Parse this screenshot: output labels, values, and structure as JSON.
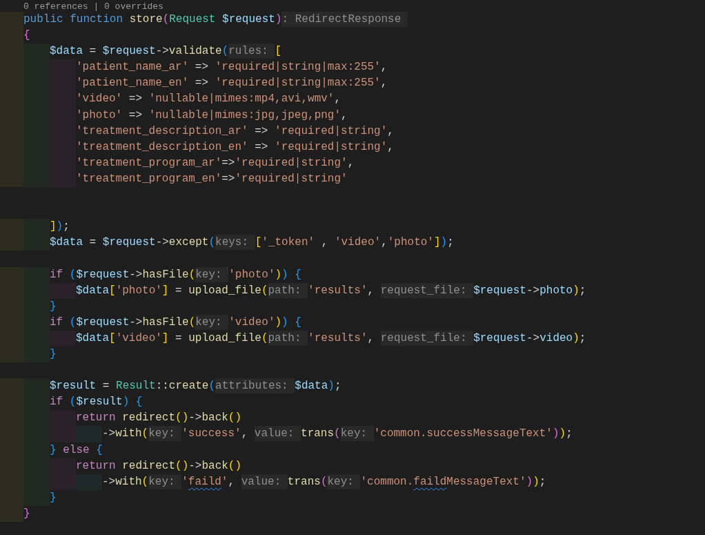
{
  "editor": {
    "codelens": "0 references | 0 overrides",
    "lines": [
      {
        "kind": "code",
        "tokens": [
          {
            "kind": "storage",
            "text": "public function "
          },
          {
            "kind": "function",
            "text": "store"
          },
          {
            "kind": "bracket",
            "text": "(",
            "color": "#da70d6"
          },
          {
            "kind": "type",
            "text": "Request "
          },
          {
            "kind": "variable",
            "text": "$request"
          },
          {
            "kind": "bracket",
            "text": ")",
            "color": "#da70d6"
          },
          {
            "kind": "hint",
            "text": ": RedirectResponse"
          }
        ]
      },
      {
        "kind": "code",
        "tokens": [
          {
            "kind": "bracket",
            "text": "{",
            "color": "#da70d6"
          }
        ],
        "children": [
          {
            "kind": "code",
            "tokens": [
              {
                "kind": "variable",
                "text": "$data"
              },
              {
                "kind": "plain",
                "text": " = "
              },
              {
                "kind": "variable",
                "text": "$request"
              },
              {
                "kind": "plain",
                "text": "->"
              },
              {
                "kind": "function",
                "text": "validate"
              },
              {
                "kind": "bracket",
                "text": "(",
                "color": "#179fff"
              },
              {
                "kind": "hint",
                "text": "rules:"
              },
              {
                "kind": "bracket",
                "text": "[",
                "color": "#ffd700"
              }
            ],
            "children": [
              {
                "kind": "code",
                "tokens": [
                  {
                    "kind": "string",
                    "text": "'patient_name_ar'"
                  },
                  {
                    "kind": "plain",
                    "text": " => "
                  },
                  {
                    "kind": "string",
                    "text": "'required|string|max:255'"
                  },
                  {
                    "kind": "plain",
                    "text": ","
                  }
                ]
              },
              {
                "kind": "code",
                "tokens": [
                  {
                    "kind": "string",
                    "text": "'patient_name_en'"
                  },
                  {
                    "kind": "plain",
                    "text": " => "
                  },
                  {
                    "kind": "string",
                    "text": "'required|string|max:255'"
                  },
                  {
                    "kind": "plain",
                    "text": ","
                  }
                ]
              },
              {
                "kind": "code",
                "tokens": [
                  {
                    "kind": "string",
                    "text": "'video'"
                  },
                  {
                    "kind": "plain",
                    "text": " => "
                  },
                  {
                    "kind": "string",
                    "text": "'nullable|mimes:mp4,avi,wmv'"
                  },
                  {
                    "kind": "plain",
                    "text": ","
                  }
                ]
              },
              {
                "kind": "code",
                "tokens": [
                  {
                    "kind": "string",
                    "text": "'photo'"
                  },
                  {
                    "kind": "plain",
                    "text": " => "
                  },
                  {
                    "kind": "string",
                    "text": "'nullable|mimes:jpg,jpeg,png'"
                  },
                  {
                    "kind": "plain",
                    "text": ","
                  }
                ]
              },
              {
                "kind": "code",
                "tokens": [
                  {
                    "kind": "string",
                    "text": "'treatment_description_ar'"
                  },
                  {
                    "kind": "plain",
                    "text": " => "
                  },
                  {
                    "kind": "string",
                    "text": "'required|string'"
                  },
                  {
                    "kind": "plain",
                    "text": ","
                  }
                ]
              },
              {
                "kind": "code",
                "tokens": [
                  {
                    "kind": "string",
                    "text": "'treatment_description_en'"
                  },
                  {
                    "kind": "plain",
                    "text": " => "
                  },
                  {
                    "kind": "string",
                    "text": "'required|string'"
                  },
                  {
                    "kind": "plain",
                    "text": ","
                  }
                ]
              },
              {
                "kind": "code",
                "tokens": [
                  {
                    "kind": "string",
                    "text": "'treatment_program_ar'"
                  },
                  {
                    "kind": "plain",
                    "text": "=>"
                  },
                  {
                    "kind": "string",
                    "text": "'required|string'"
                  },
                  {
                    "kind": "plain",
                    "text": ","
                  }
                ]
              },
              {
                "kind": "code",
                "tokens": [
                  {
                    "kind": "string",
                    "text": "'treatment_program_en'"
                  },
                  {
                    "kind": "plain",
                    "text": "=>"
                  },
                  {
                    "kind": "string",
                    "text": "'required|string'"
                  }
                ]
              },
              {
                "kind": "blank"
              },
              {
                "kind": "blank"
              }
            ]
          },
          {
            "kind": "code",
            "tokens": [
              {
                "kind": "bracket",
                "text": "]",
                "color": "#ffd700"
              },
              {
                "kind": "bracket",
                "text": ")",
                "color": "#179fff"
              },
              {
                "kind": "plain",
                "text": ";"
              }
            ]
          },
          {
            "kind": "code",
            "tokens": [
              {
                "kind": "variable",
                "text": "$data"
              },
              {
                "kind": "plain",
                "text": " = "
              },
              {
                "kind": "variable",
                "text": "$request"
              },
              {
                "kind": "plain",
                "text": "->"
              },
              {
                "kind": "function",
                "text": "except"
              },
              {
                "kind": "bracket",
                "text": "(",
                "color": "#179fff"
              },
              {
                "kind": "hint",
                "text": "keys:"
              },
              {
                "kind": "bracket",
                "text": "[",
                "color": "#ffd700"
              },
              {
                "kind": "string",
                "text": "'_token'"
              },
              {
                "kind": "plain",
                "text": " , "
              },
              {
                "kind": "string",
                "text": "'video'"
              },
              {
                "kind": "plain",
                "text": ","
              },
              {
                "kind": "string",
                "text": "'photo'"
              },
              {
                "kind": "bracket",
                "text": "]",
                "color": "#ffd700"
              },
              {
                "kind": "bracket",
                "text": ")",
                "color": "#179fff"
              },
              {
                "kind": "plain",
                "text": ";"
              }
            ]
          },
          {
            "kind": "blank"
          },
          {
            "kind": "code",
            "tokens": [
              {
                "kind": "control",
                "text": "if "
              },
              {
                "kind": "bracket",
                "text": "(",
                "color": "#179fff"
              },
              {
                "kind": "variable",
                "text": "$request"
              },
              {
                "kind": "plain",
                "text": "->"
              },
              {
                "kind": "function",
                "text": "hasFile"
              },
              {
                "kind": "bracket",
                "text": "(",
                "color": "#ffd700"
              },
              {
                "kind": "hint",
                "text": "key:"
              },
              {
                "kind": "string",
                "text": "'photo'"
              },
              {
                "kind": "bracket",
                "text": ")",
                "color": "#ffd700"
              },
              {
                "kind": "bracket",
                "text": ")",
                "color": "#179fff"
              },
              {
                "kind": "bracket",
                "text": " {",
                "color": "#179fff"
              }
            ],
            "children": [
              {
                "kind": "code",
                "tokens": [
                  {
                    "kind": "variable",
                    "text": "$data"
                  },
                  {
                    "kind": "bracket",
                    "text": "[",
                    "color": "#ffd700"
                  },
                  {
                    "kind": "string",
                    "text": "'photo'"
                  },
                  {
                    "kind": "bracket",
                    "text": "]",
                    "color": "#ffd700"
                  },
                  {
                    "kind": "plain",
                    "text": " = "
                  },
                  {
                    "kind": "function",
                    "text": "upload_file"
                  },
                  {
                    "kind": "bracket",
                    "text": "(",
                    "color": "#ffd700"
                  },
                  {
                    "kind": "hint",
                    "text": "path:"
                  },
                  {
                    "kind": "string",
                    "text": "'results'"
                  },
                  {
                    "kind": "plain",
                    "text": ", "
                  },
                  {
                    "kind": "hint",
                    "text": "request_file:"
                  },
                  {
                    "kind": "variable",
                    "text": "$request"
                  },
                  {
                    "kind": "plain",
                    "text": "->"
                  },
                  {
                    "kind": "variable",
                    "text": "photo"
                  },
                  {
                    "kind": "bracket",
                    "text": ")",
                    "color": "#ffd700"
                  },
                  {
                    "kind": "plain",
                    "text": ";"
                  }
                ]
              }
            ]
          },
          {
            "kind": "code",
            "tokens": [
              {
                "kind": "bracket",
                "text": "}",
                "color": "#179fff"
              }
            ]
          },
          {
            "kind": "code",
            "tokens": [
              {
                "kind": "control",
                "text": "if "
              },
              {
                "kind": "bracket",
                "text": "(",
                "color": "#179fff"
              },
              {
                "kind": "variable",
                "text": "$request"
              },
              {
                "kind": "plain",
                "text": "->"
              },
              {
                "kind": "function",
                "text": "hasFile"
              },
              {
                "kind": "bracket",
                "text": "(",
                "color": "#ffd700"
              },
              {
                "kind": "hint",
                "text": "key:"
              },
              {
                "kind": "string",
                "text": "'video'"
              },
              {
                "kind": "bracket",
                "text": ")",
                "color": "#ffd700"
              },
              {
                "kind": "bracket",
                "text": ")",
                "color": "#179fff"
              },
              {
                "kind": "bracket",
                "text": " {",
                "color": "#179fff"
              }
            ],
            "children": [
              {
                "kind": "code",
                "tokens": [
                  {
                    "kind": "variable",
                    "text": "$data"
                  },
                  {
                    "kind": "bracket",
                    "text": "[",
                    "color": "#ffd700"
                  },
                  {
                    "kind": "string",
                    "text": "'video'"
                  },
                  {
                    "kind": "bracket",
                    "text": "]",
                    "color": "#ffd700"
                  },
                  {
                    "kind": "plain",
                    "text": " = "
                  },
                  {
                    "kind": "function",
                    "text": "upload_file"
                  },
                  {
                    "kind": "bracket",
                    "text": "(",
                    "color": "#ffd700"
                  },
                  {
                    "kind": "hint",
                    "text": "path:"
                  },
                  {
                    "kind": "string",
                    "text": "'results'"
                  },
                  {
                    "kind": "plain",
                    "text": ", "
                  },
                  {
                    "kind": "hint",
                    "text": "request_file:"
                  },
                  {
                    "kind": "variable",
                    "text": "$request"
                  },
                  {
                    "kind": "plain",
                    "text": "->"
                  },
                  {
                    "kind": "variable",
                    "text": "video"
                  },
                  {
                    "kind": "bracket",
                    "text": ")",
                    "color": "#ffd700"
                  },
                  {
                    "kind": "plain",
                    "text": ";"
                  }
                ]
              }
            ]
          },
          {
            "kind": "code",
            "tokens": [
              {
                "kind": "bracket",
                "text": "}",
                "color": "#179fff"
              }
            ]
          },
          {
            "kind": "blank"
          },
          {
            "kind": "code",
            "tokens": [
              {
                "kind": "variable",
                "text": "$result"
              },
              {
                "kind": "plain",
                "text": " = "
              },
              {
                "kind": "type",
                "text": "Result"
              },
              {
                "kind": "plain",
                "text": "::"
              },
              {
                "kind": "function",
                "text": "create"
              },
              {
                "kind": "bracket",
                "text": "(",
                "color": "#179fff"
              },
              {
                "kind": "hint",
                "text": "attributes:"
              },
              {
                "kind": "variable",
                "text": "$data"
              },
              {
                "kind": "bracket",
                "text": ")",
                "color": "#179fff"
              },
              {
                "kind": "plain",
                "text": ";"
              }
            ]
          },
          {
            "kind": "code",
            "tokens": [
              {
                "kind": "control",
                "text": "if "
              },
              {
                "kind": "bracket",
                "text": "(",
                "color": "#179fff"
              },
              {
                "kind": "variable",
                "text": "$result"
              },
              {
                "kind": "bracket",
                "text": ")",
                "color": "#179fff"
              },
              {
                "kind": "bracket",
                "text": " {",
                "color": "#179fff"
              }
            ],
            "children": [
              {
                "kind": "code",
                "tokens": [
                  {
                    "kind": "control",
                    "text": "return "
                  },
                  {
                    "kind": "function",
                    "text": "redirect"
                  },
                  {
                    "kind": "bracket",
                    "text": "(",
                    "color": "#ffd700"
                  },
                  {
                    "kind": "bracket",
                    "text": ")",
                    "color": "#ffd700"
                  },
                  {
                    "kind": "plain",
                    "text": "->"
                  },
                  {
                    "kind": "function",
                    "text": "back"
                  },
                  {
                    "kind": "bracket",
                    "text": "(",
                    "color": "#ffd700"
                  },
                  {
                    "kind": "bracket",
                    "text": ")",
                    "color": "#ffd700"
                  }
                ],
                "children": [
                  {
                    "kind": "code",
                    "tokens": [
                      {
                        "kind": "plain",
                        "text": "->"
                      },
                      {
                        "kind": "function",
                        "text": "with"
                      },
                      {
                        "kind": "bracket",
                        "text": "(",
                        "color": "#ffd700"
                      },
                      {
                        "kind": "hint",
                        "text": "key:"
                      },
                      {
                        "kind": "string",
                        "text": "'success'"
                      },
                      {
                        "kind": "plain",
                        "text": ", "
                      },
                      {
                        "kind": "hint",
                        "text": "value:"
                      },
                      {
                        "kind": "function",
                        "text": "trans"
                      },
                      {
                        "kind": "bracket",
                        "text": "(",
                        "color": "#da70d6"
                      },
                      {
                        "kind": "hint",
                        "text": "key:"
                      },
                      {
                        "kind": "string",
                        "text": "'common.successMessageText'"
                      },
                      {
                        "kind": "bracket",
                        "text": ")",
                        "color": "#da70d6"
                      },
                      {
                        "kind": "bracket",
                        "text": ")",
                        "color": "#ffd700"
                      },
                      {
                        "kind": "plain",
                        "text": ";"
                      }
                    ]
                  }
                ]
              }
            ]
          },
          {
            "kind": "code",
            "tokens": [
              {
                "kind": "bracket",
                "text": "}",
                "color": "#179fff"
              },
              {
                "kind": "control",
                "text": " else "
              },
              {
                "kind": "bracket",
                "text": "{",
                "color": "#179fff"
              }
            ],
            "children": [
              {
                "kind": "code",
                "tokens": [
                  {
                    "kind": "control",
                    "text": "return "
                  },
                  {
                    "kind": "function",
                    "text": "redirect"
                  },
                  {
                    "kind": "bracket",
                    "text": "(",
                    "color": "#ffd700"
                  },
                  {
                    "kind": "bracket",
                    "text": ")",
                    "color": "#ffd700"
                  },
                  {
                    "kind": "plain",
                    "text": "->"
                  },
                  {
                    "kind": "function",
                    "text": "back"
                  },
                  {
                    "kind": "bracket",
                    "text": "(",
                    "color": "#ffd700"
                  },
                  {
                    "kind": "bracket",
                    "text": ")",
                    "color": "#ffd700"
                  }
                ],
                "children": [
                  {
                    "kind": "code",
                    "tokens": [
                      {
                        "kind": "plain",
                        "text": "->"
                      },
                      {
                        "kind": "function",
                        "text": "with"
                      },
                      {
                        "kind": "bracket",
                        "text": "(",
                        "color": "#ffd700"
                      },
                      {
                        "kind": "hint",
                        "text": "key:"
                      },
                      {
                        "kind": "string",
                        "text": "'"
                      },
                      {
                        "kind": "string",
                        "text": "faild",
                        "misspelled": true
                      },
                      {
                        "kind": "string",
                        "text": "'"
                      },
                      {
                        "kind": "plain",
                        "text": ", "
                      },
                      {
                        "kind": "hint",
                        "text": "value:"
                      },
                      {
                        "kind": "function",
                        "text": "trans"
                      },
                      {
                        "kind": "bracket",
                        "text": "(",
                        "color": "#da70d6"
                      },
                      {
                        "kind": "hint",
                        "text": "key:"
                      },
                      {
                        "kind": "string",
                        "text": "'common."
                      },
                      {
                        "kind": "string",
                        "text": "faild",
                        "misspelled": true
                      },
                      {
                        "kind": "string",
                        "text": "MessageText'"
                      },
                      {
                        "kind": "bracket",
                        "text": ")",
                        "color": "#da70d6"
                      },
                      {
                        "kind": "bracket",
                        "text": ")",
                        "color": "#ffd700"
                      },
                      {
                        "kind": "plain",
                        "text": ";"
                      }
                    ]
                  }
                ]
              }
            ]
          },
          {
            "kind": "code",
            "tokens": [
              {
                "kind": "bracket",
                "text": "}",
                "color": "#179fff"
              }
            ]
          }
        ]
      },
      {
        "kind": "code",
        "tokens": [
          {
            "kind": "bracket",
            "text": "}",
            "color": "#da70d6"
          }
        ]
      }
    ]
  }
}
